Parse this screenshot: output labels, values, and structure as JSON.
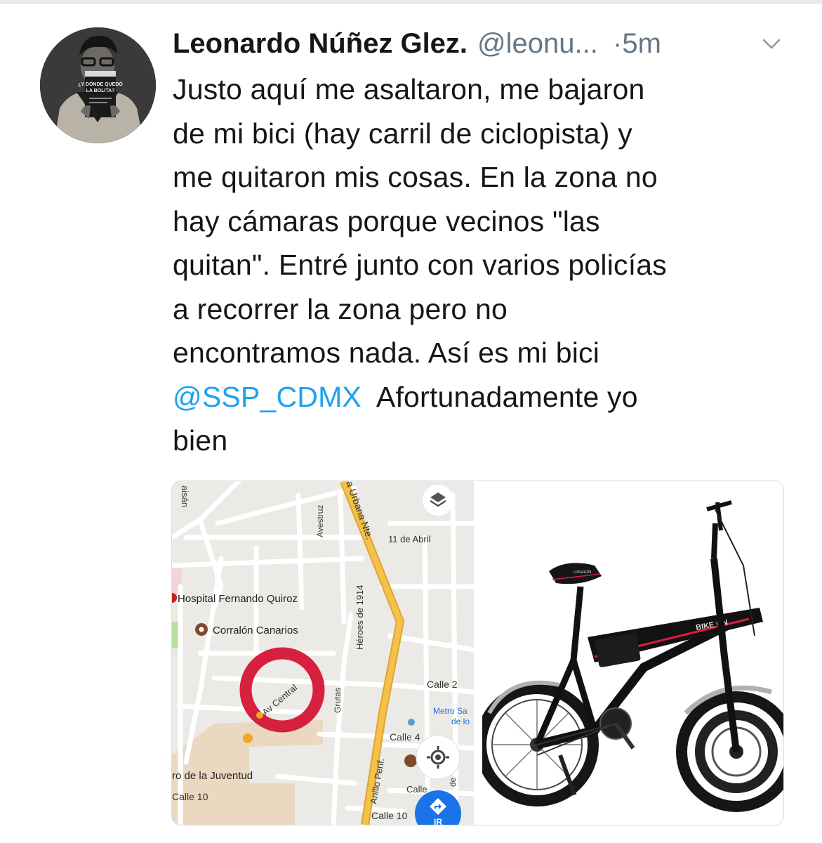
{
  "author": {
    "name": "Leonardo Núñez Glez.",
    "handle": "@leonu...",
    "separator": "·",
    "time": "5m"
  },
  "tweet": {
    "lines": [
      "Justo aquí me asaltaron, me bajaron",
      "de mi bici (hay carril de ciclopista) y",
      "me quitaron mis cosas. En la zona no",
      "hay cámaras porque vecinos \"las",
      "quitan\". Entré junto con varios policías",
      "a recorrer la zona pero no",
      "encontramos nada. Así es mi bici"
    ],
    "mention": "@SSP_CDMX",
    "after_mention": "  Afortunadamente yo",
    "last_line": "bien"
  },
  "avatar": {
    "book_line1": "¿Y DÓNDE QUEDÓ",
    "book_line2": "LA BOLITA?"
  },
  "map": {
    "labels": {
      "faisan": "aisán",
      "avestruz": "Avestruz",
      "via_urbana": "a Urbana Nte.",
      "abril": "11 de Abril",
      "hospital": "Hospital Fernando Quiroz",
      "corralon": "Corralón Canarios",
      "heroes": "Héroes de 1914",
      "grutas": "Grutas",
      "calle2": "Calle 2",
      "metro1": "Metro Sa",
      "metro2": "de lo",
      "av_central": "Av Central",
      "calle4": "Calle 4",
      "periferico": "Anillo Perif.",
      "juventud": "ro de la Juventud",
      "calle10a": "Calle 10",
      "calle_c": "Calle",
      "de": "de",
      "calle10b": "Calle 10",
      "ir": "IR"
    },
    "icons": [
      "layers-icon",
      "my-location-icon",
      "directions-icon"
    ],
    "colors": {
      "circle": "#d71f3f",
      "highway": "#f1b43a",
      "road": "#ffffff",
      "fab": "#1a73e8"
    }
  },
  "bike": {
    "frame_text": "BIKE ON",
    "seat_text": "UrbanON"
  }
}
